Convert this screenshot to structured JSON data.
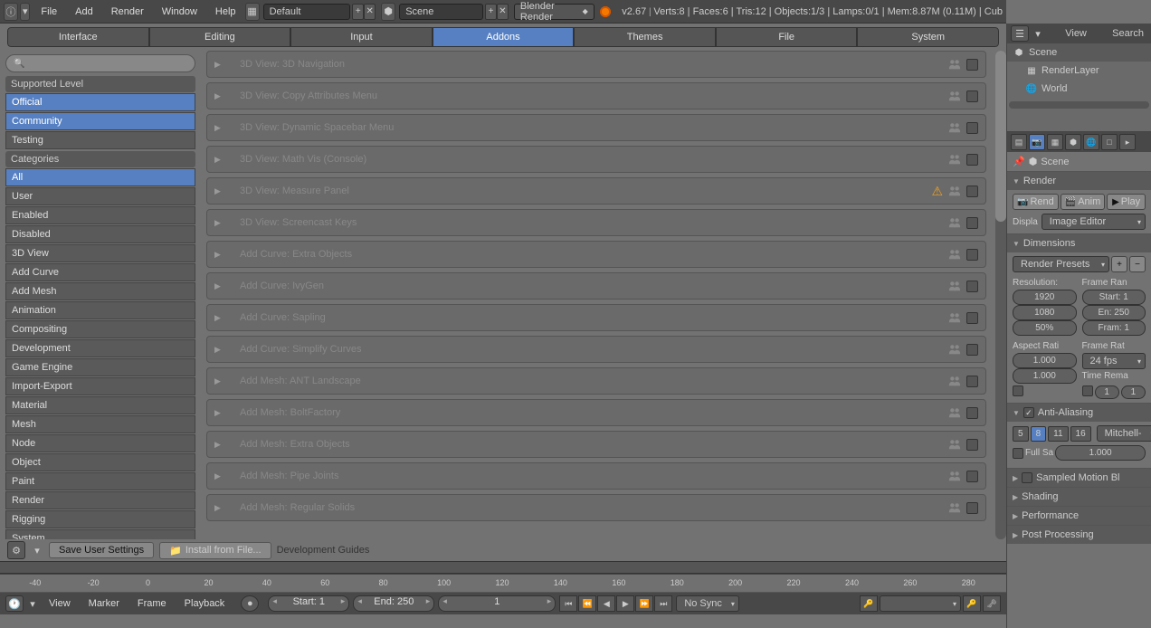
{
  "top": {
    "menus": [
      "File",
      "Add",
      "Render",
      "Window",
      "Help"
    ],
    "layout": "Default",
    "scene": "Scene",
    "engine": "Blender Render",
    "version": "v2.67",
    "stats": "Verts:8 | Faces:6 | Tris:12 | Objects:1/3 | Lamps:0/1 | Mem:8.87M (0.11M) | Cub"
  },
  "pref_tabs": [
    "Interface",
    "Editing",
    "Input",
    "Addons",
    "Themes",
    "File",
    "System"
  ],
  "pref_active": "Addons",
  "sidebar": {
    "supported_header": "Supported Level",
    "supported": [
      "Official",
      "Community",
      "Testing"
    ],
    "supported_selected": [
      "Official",
      "Community"
    ],
    "categories_header": "Categories",
    "categories": [
      "All",
      "User",
      "Enabled",
      "Disabled",
      "3D View",
      "Add Curve",
      "Add Mesh",
      "Animation",
      "Compositing",
      "Development",
      "Game Engine",
      "Import-Export",
      "Material",
      "Mesh",
      "Node",
      "Object",
      "Paint",
      "Render",
      "Rigging",
      "System"
    ],
    "categories_selected": "All"
  },
  "addons": [
    {
      "name": "3D View: 3D Navigation"
    },
    {
      "name": "3D View: Copy Attributes Menu"
    },
    {
      "name": "3D View: Dynamic Spacebar Menu"
    },
    {
      "name": "3D View: Math Vis (Console)",
      "special": true
    },
    {
      "name": "3D View: Measure Panel",
      "warning": true
    },
    {
      "name": "3D View: Screencast Keys"
    },
    {
      "name": "Add Curve: Extra Objects"
    },
    {
      "name": "Add Curve: IvyGen"
    },
    {
      "name": "Add Curve: Sapling"
    },
    {
      "name": "Add Curve: Simplify Curves"
    },
    {
      "name": "Add Mesh: ANT Landscape"
    },
    {
      "name": "Add Mesh: BoltFactory"
    },
    {
      "name": "Add Mesh: Extra Objects"
    },
    {
      "name": "Add Mesh: Pipe Joints"
    },
    {
      "name": "Add Mesh: Regular Solids"
    }
  ],
  "bottom": {
    "save": "Save User Settings",
    "install": "Install from File...",
    "dev": "Development Guides"
  },
  "timeline": {
    "menus": [
      "View",
      "Marker",
      "Frame",
      "Playback"
    ],
    "start_label": "Start: 1",
    "end_label": "End: 250",
    "current": "1",
    "sync": "No Sync",
    "ticks": [
      -40,
      -20,
      0,
      20,
      40,
      60,
      80,
      100,
      120,
      140,
      160,
      180,
      200,
      220,
      240,
      260,
      280
    ]
  },
  "outliner": {
    "view": "View",
    "search": "Search",
    "items": [
      "Scene",
      "RenderLayer",
      "World"
    ]
  },
  "props": {
    "breadcrumb": "Scene",
    "render_header": "Render",
    "render_btn": "Rend",
    "anim_btn": "Anim",
    "play_btn": "Play",
    "display_label": "Displa",
    "display_value": "Image Editor",
    "dimensions_header": "Dimensions",
    "presets": "Render Presets",
    "resolution_label": "Resolution:",
    "frame_range_label": "Frame Ran",
    "res_x": "1920",
    "res_y": "1080",
    "res_pct": "50%",
    "start": "Start: 1",
    "end": "En: 250",
    "step": "Fram: 1",
    "aspect_label": "Aspect Rati",
    "framerate_label": "Frame Rat",
    "aspect_x": "1.000",
    "aspect_y": "1.000",
    "fps": "24 fps",
    "time_remap": "Time Rema",
    "remap_old": "1",
    "remap_new": "1",
    "aa_header": "Anti-Aliasing",
    "aa_samples": [
      "5",
      "8",
      "11",
      "16"
    ],
    "aa_selected": "8",
    "aa_filter": "Mitchell-",
    "full_sample": "Full Sa",
    "aa_size": "1.000",
    "sampled_motion": "Sampled Motion Bl",
    "shading": "Shading",
    "performance": "Performance",
    "post": "Post Processing"
  }
}
